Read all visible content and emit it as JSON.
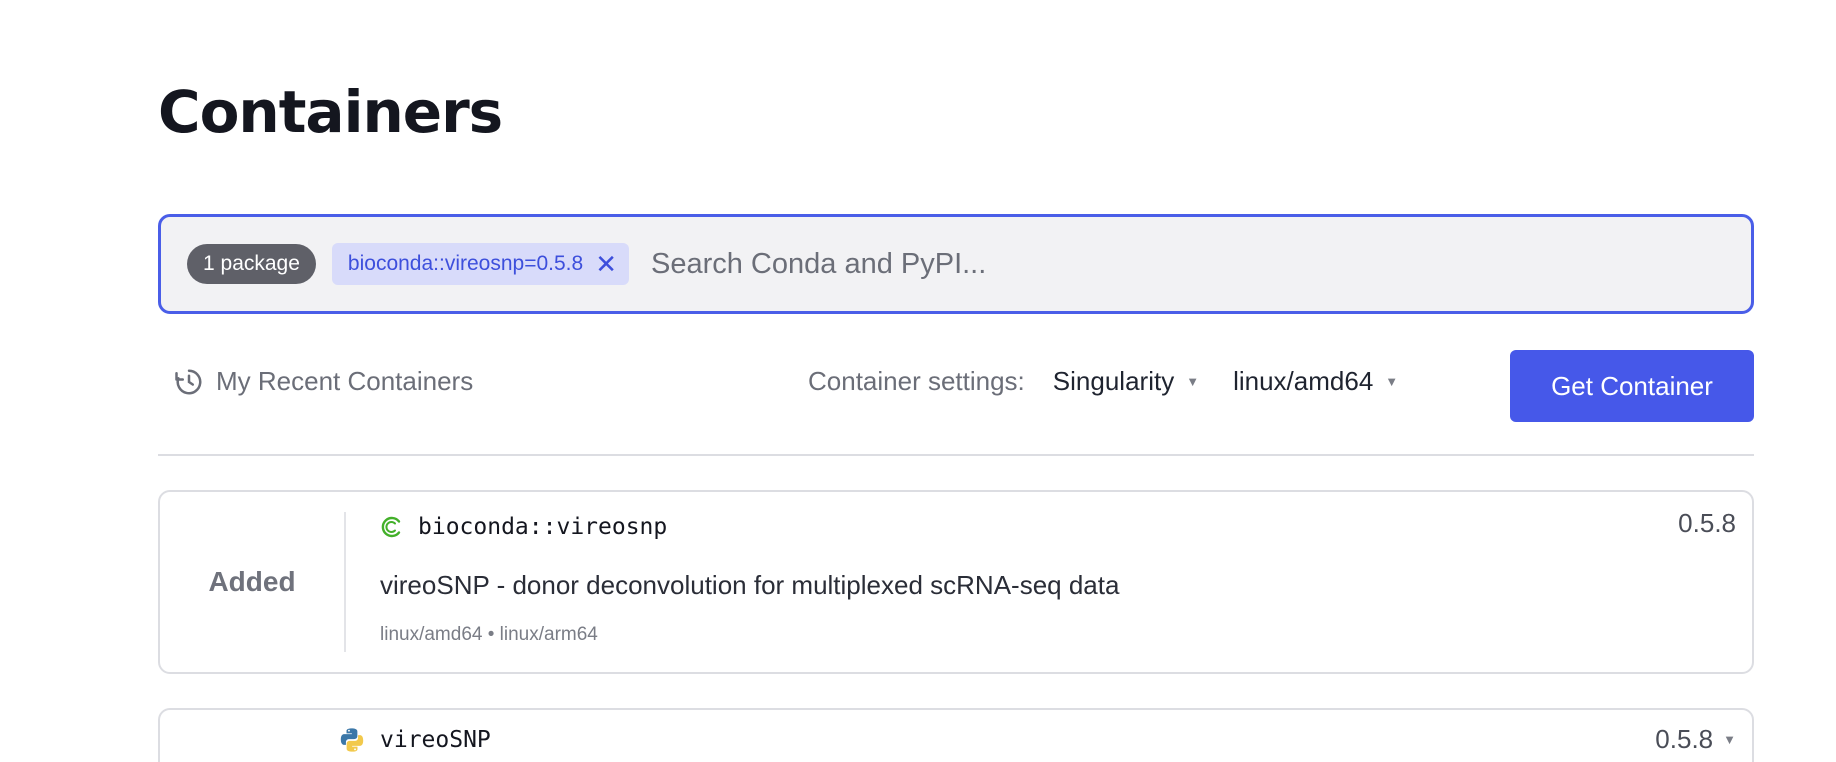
{
  "page": {
    "title": "Containers"
  },
  "search": {
    "package_count": "1 package",
    "selected_chip": "bioconda::vireosnp=0.5.8",
    "chip_close": "✕",
    "placeholder": "Search Conda and PyPI..."
  },
  "toolbar": {
    "recent_label": "My Recent Containers",
    "settings_label": "Container settings:",
    "format_value": "Singularity",
    "platform_value": "linux/amd64",
    "get_button": "Get Container"
  },
  "results": [
    {
      "status": "Added",
      "name": "bioconda::vireosnp",
      "icon": "conda-icon",
      "version": "0.5.8",
      "description": "vireoSNP - donor deconvolution for multiplexed scRNA-seq data",
      "platforms": "linux/amd64 • linux/arm64"
    },
    {
      "name": "vireoSNP",
      "icon": "python-icon",
      "version": "0.5.8"
    }
  ],
  "colors": {
    "accent": "#4658e9",
    "chip_bg": "#d8dbfa",
    "conda_green": "#43b02a",
    "python_blue": "#3b77a8",
    "python_yellow": "#f2c94c"
  }
}
